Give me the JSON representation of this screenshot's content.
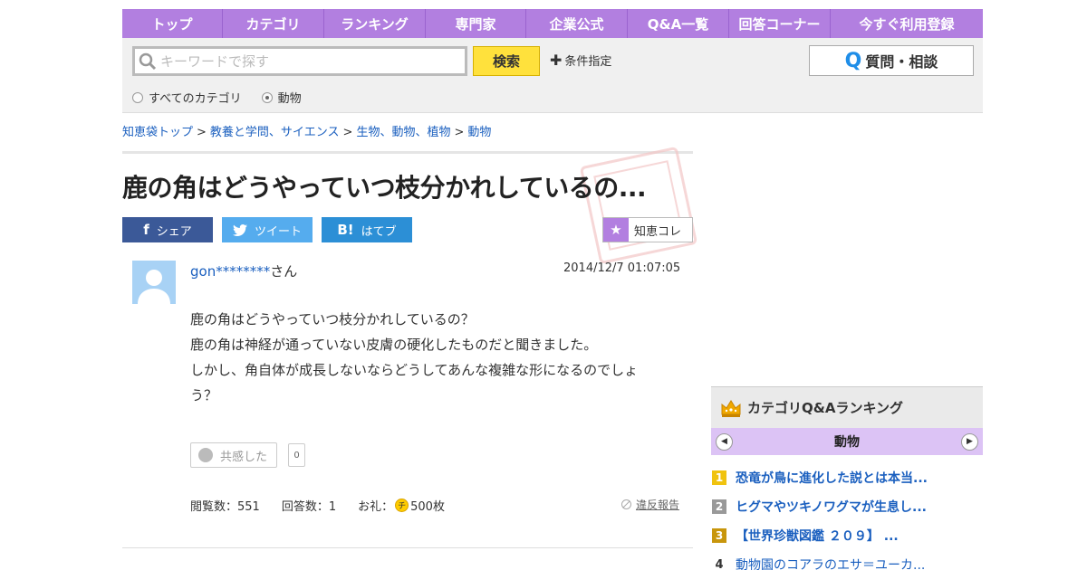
{
  "nav": {
    "items": [
      "トップ",
      "カテゴリ",
      "ランキング",
      "専門家",
      "企業公式",
      "Q&A一覧",
      "回答コーナー",
      "今すぐ利用登録"
    ]
  },
  "search": {
    "placeholder": "キーワードで探す",
    "button": "検索",
    "conditions": "条件指定",
    "ask_button": "質問・相談",
    "ask_icon": "Q"
  },
  "radios": {
    "all": "すべてのカテゴリ",
    "current": "動物",
    "selected": "current"
  },
  "breadcrumb": {
    "items": [
      "知恵袋トップ",
      "教養と学問、サイエンス",
      "生物、動物、植物",
      "動物"
    ],
    "sep": ">"
  },
  "question": {
    "title": "鹿の角はどうやっていつ枝分かれしているの...",
    "share": {
      "facebook": "シェア",
      "twitter": "ツイート",
      "hatena": "はてブ",
      "hatena_icon": "B!"
    },
    "chiekore": "知恵コレ",
    "user": "gon********",
    "user_suffix": "さん",
    "date": "2014/12/7  01:07:05",
    "body": [
      "鹿の角はどうやっていつ枝分かれしているの？",
      "鹿の角は神経が通っていない皮膚の硬化したものだと聞きました。",
      "しかし、角自体が成長しないならどうしてあんな複雑な形になるのでしょ",
      "う？"
    ],
    "empathy_label": "共感した",
    "empathy_count": "0",
    "views_label": "閲覧数：551",
    "answers_label": "回答数：1",
    "reward_prefix": "お礼：",
    "coin_char": "チ",
    "reward_value": "500枚",
    "report": "違反報告"
  },
  "ranking": {
    "title": "カテゴリQ&Aランキング",
    "category": "動物",
    "items": [
      {
        "rank": "1",
        "text": "恐竜が鳥に進化した説とは本当..."
      },
      {
        "rank": "2",
        "text": "ヒグマやツキノワグマが生息し..."
      },
      {
        "rank": "3",
        "text": "【世界珍獣図鑑 ２０９】 ..."
      },
      {
        "rank": "4",
        "text": "動物園のコアラのエサ＝ユーカ..."
      }
    ]
  },
  "colors": {
    "nav": "#b27fe0",
    "search_button": "#ffe13c",
    "link": "#1a5fbf",
    "facebook": "#3b5998",
    "twitter": "#55acee",
    "hatena": "#2c8fd6",
    "rank_category": "#dcc3f5"
  }
}
